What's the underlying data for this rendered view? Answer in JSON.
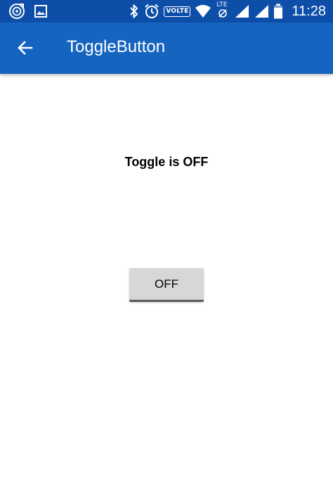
{
  "status_bar": {
    "time": "11:28",
    "volte_label": "VOLTE",
    "lte_label": "LTE",
    "icons_left": [
      "music-sync-icon",
      "gallery-icon"
    ],
    "icons_right": [
      "bluetooth-icon",
      "alarm-icon",
      "volte-badge",
      "wifi-icon",
      "lte-signal-icon",
      "signal-icon",
      "battery-icon"
    ]
  },
  "app_bar": {
    "title": "ToggleButton",
    "back_icon": "arrow-back-icon",
    "background": "#1565c0"
  },
  "main": {
    "status_text": "Toggle is OFF",
    "toggle": {
      "label": "OFF",
      "checked": false
    }
  },
  "colors": {
    "status_bar": "#0d4fa8",
    "app_bar": "#1565c0",
    "button": "#d6d7d7",
    "button_indicator": "#5a5a5a"
  }
}
